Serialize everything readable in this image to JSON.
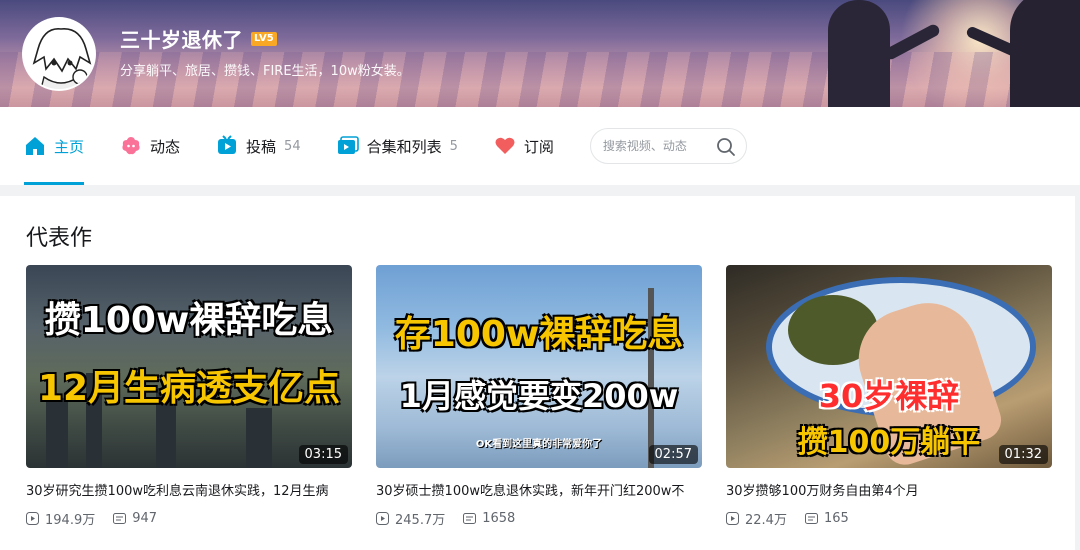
{
  "profile": {
    "username": "三十岁退休了",
    "level_badge": "LV5",
    "sign": "分享躺平、旅居、攒钱、FIRE生活，10w粉女装。"
  },
  "nav": {
    "home": "主页",
    "dynamic": "动态",
    "uploads": "投稿",
    "uploads_count": "54",
    "collections": "合集和列表",
    "collections_count": "5",
    "subscribe": "订阅",
    "search_placeholder": "搜索视频、动态"
  },
  "section_title": "代表作",
  "videos": [
    {
      "title": "30岁研究生攒100w吃利息云南退休实践，12月生病",
      "duration": "03:15",
      "plays": "194.9万",
      "danmaku": "947",
      "cover_line1": "攒100w裸辞吃息",
      "cover_line2": "12月生病透支亿点"
    },
    {
      "title": "30岁硕士攒100w吃息退休实践，新年开门红200w不",
      "duration": "02:57",
      "plays": "245.7万",
      "danmaku": "1658",
      "cover_line1": "存100w裸辞吃息",
      "cover_line2": "1月感觉要变200w",
      "cover_line3": "OK看到这里真的非常爱你了"
    },
    {
      "title": "30岁攒够100万财务自由第4个月",
      "duration": "01:32",
      "plays": "22.4万",
      "danmaku": "165",
      "cover_line1": "30岁裸辞",
      "cover_line2": "攒100万躺平"
    }
  ],
  "colors": {
    "accent": "#00a1d6",
    "level_badge": "#f9a825",
    "subscribe_heart": "#f25d5d"
  }
}
